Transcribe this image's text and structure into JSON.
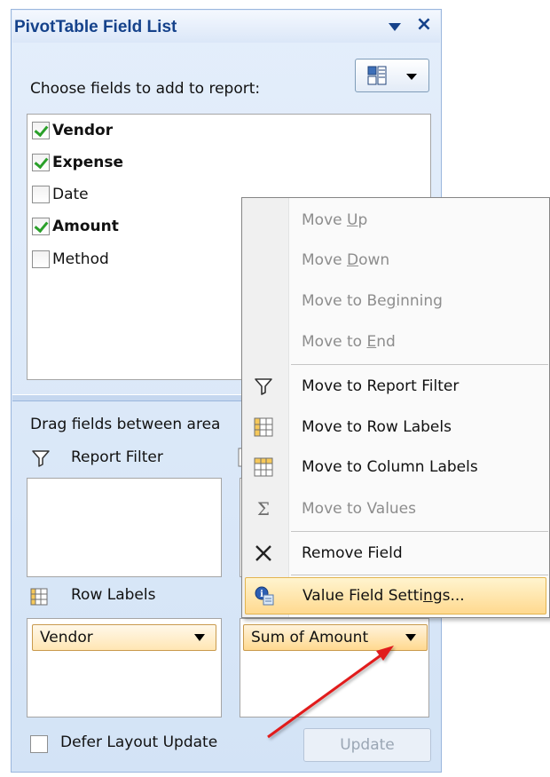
{
  "pane": {
    "title": "PivotTable Field List",
    "choose_label": "Choose fields to add to report:",
    "fields": [
      {
        "label": "Vendor",
        "checked": true
      },
      {
        "label": "Expense",
        "checked": true
      },
      {
        "label": "Date",
        "checked": false
      },
      {
        "label": "Amount",
        "checked": true
      },
      {
        "label": "Method",
        "checked": false
      }
    ],
    "drag_label": "Drag fields between area",
    "report_filter_label": "Report Filter",
    "row_labels_label": "Row Labels",
    "row_pill": "Vendor",
    "values_pill": "Sum of Amount",
    "defer_label": "Defer Layout Update",
    "update_label": "Update"
  },
  "context_menu": {
    "items": [
      {
        "pre": "Move ",
        "ul": "U",
        "post": "p",
        "disabled": true
      },
      {
        "pre": "Move ",
        "ul": "D",
        "post": "own",
        "disabled": true
      },
      {
        "pre": "Move to Be",
        "ul": "g",
        "post": "inning",
        "disabled": true
      },
      {
        "pre": "Move to ",
        "ul": "E",
        "post": "nd",
        "disabled": true
      },
      {
        "pre": "Move to Report Filter",
        "ul": "",
        "post": "",
        "disabled": false,
        "icon": "filter-icon"
      },
      {
        "pre": "Move to Row Labels",
        "ul": "",
        "post": "",
        "disabled": false,
        "icon": "row-labels-icon"
      },
      {
        "pre": "Move to Column Labels",
        "ul": "",
        "post": "",
        "disabled": false,
        "icon": "column-labels-icon"
      },
      {
        "pre": "Move to Values",
        "ul": "",
        "post": "",
        "disabled": true,
        "icon": "sigma-icon"
      },
      {
        "pre": "Remove Field",
        "ul": "",
        "post": "",
        "disabled": false,
        "icon": "remove-icon"
      },
      {
        "pre": "Value Field Setti",
        "ul": "n",
        "post": "gs...",
        "disabled": false,
        "icon": "value-settings-icon",
        "highlighted": true
      }
    ]
  },
  "colors": {
    "title_text": "#15428b",
    "pane_bg": "#d3e3f6",
    "menu_highlight": "#ffd98f",
    "arrow": "#e11b1b"
  }
}
